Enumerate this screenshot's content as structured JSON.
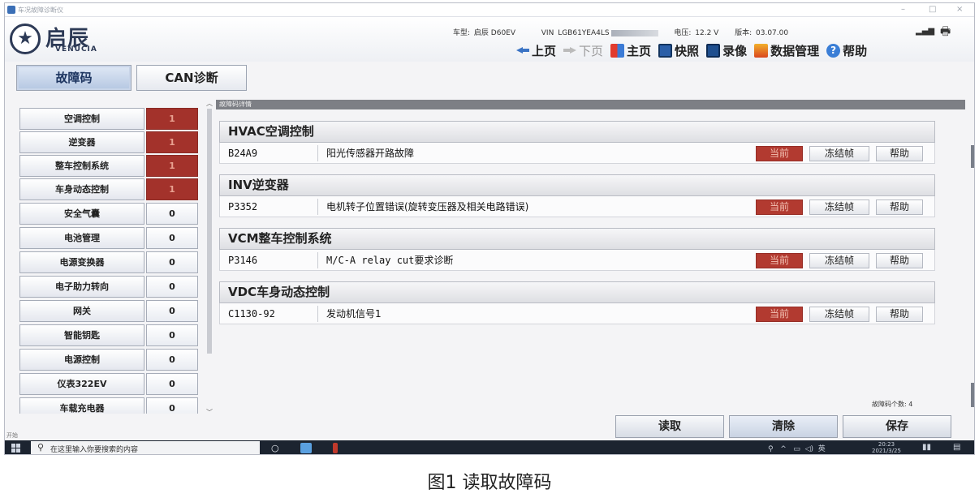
{
  "window": {
    "title": "车况故障诊断仪"
  },
  "brand": {
    "name_cn": "启辰",
    "name_en": "VENUCIA"
  },
  "vehicle_info": {
    "model_label": "车型:",
    "model_value": "启辰 D60EV",
    "vin_label": "VIN",
    "vin_value": "LGB61YEA4LS",
    "voltage_label": "电压:",
    "voltage_value": "12.2 V",
    "version_label": "版本:",
    "version_value": "03.07.00"
  },
  "toolbar": {
    "prev": "上页",
    "next": "下页",
    "home": "主页",
    "snapshot": "快照",
    "record": "录像",
    "data_mgmt": "数据管理",
    "help": "帮助"
  },
  "tabs": {
    "dtc": "故障码",
    "can": "CAN诊断"
  },
  "systems": [
    {
      "label": "空调控制",
      "count": "1",
      "error": true
    },
    {
      "label": "逆变器",
      "count": "1",
      "error": true
    },
    {
      "label": "整车控制系统",
      "count": "1",
      "error": true
    },
    {
      "label": "车身动态控制",
      "count": "1",
      "error": true
    },
    {
      "label": "安全气囊",
      "count": "0",
      "error": false
    },
    {
      "label": "电池管理",
      "count": "0",
      "error": false
    },
    {
      "label": "电源变换器",
      "count": "0",
      "error": false
    },
    {
      "label": "电子助力转向",
      "count": "0",
      "error": false
    },
    {
      "label": "网关",
      "count": "0",
      "error": false
    },
    {
      "label": "智能钥匙",
      "count": "0",
      "error": false
    },
    {
      "label": "电源控制",
      "count": "0",
      "error": false
    },
    {
      "label": "仪表322EV",
      "count": "0",
      "error": false
    },
    {
      "label": "车载充电器",
      "count": "0",
      "error": false
    }
  ],
  "detail": {
    "header": "故障码详情",
    "groups": [
      {
        "title": "HVAC空调控制",
        "code": "B24A9",
        "description": "阳光传感器开路故障",
        "status": "当前",
        "freeze": "冻结帧",
        "help": "帮助"
      },
      {
        "title": "INV逆变器",
        "code": "P3352",
        "description": "电机转子位置错误(旋转变压器及相关电路错误)",
        "status": "当前",
        "freeze": "冻结帧",
        "help": "帮助"
      },
      {
        "title": "VCM整车控制系统",
        "code": "P3146",
        "description": "M/C-A relay cut要求诊断",
        "status": "当前",
        "freeze": "冻结帧",
        "help": "帮助"
      },
      {
        "title": "VDC车身动态控制",
        "code": "C1130-92",
        "description": "发动机信号1",
        "status": "当前",
        "freeze": "冻结帧",
        "help": "帮助"
      }
    ],
    "count_label": "故障码个数:",
    "count_value": "4"
  },
  "actions": {
    "read": "读取",
    "clear": "清除",
    "save": "保存"
  },
  "start_label": "开始",
  "taskbar": {
    "search_placeholder": "在这里输入你要搜索的内容",
    "tray_lang": "英",
    "time": "20:23",
    "date": "2021/3/25"
  },
  "caption": "图1 读取故障码",
  "colors": {
    "error_red": "#a3322b",
    "brand_navy": "#2d3a56",
    "accent_blue": "#3a73c4"
  }
}
